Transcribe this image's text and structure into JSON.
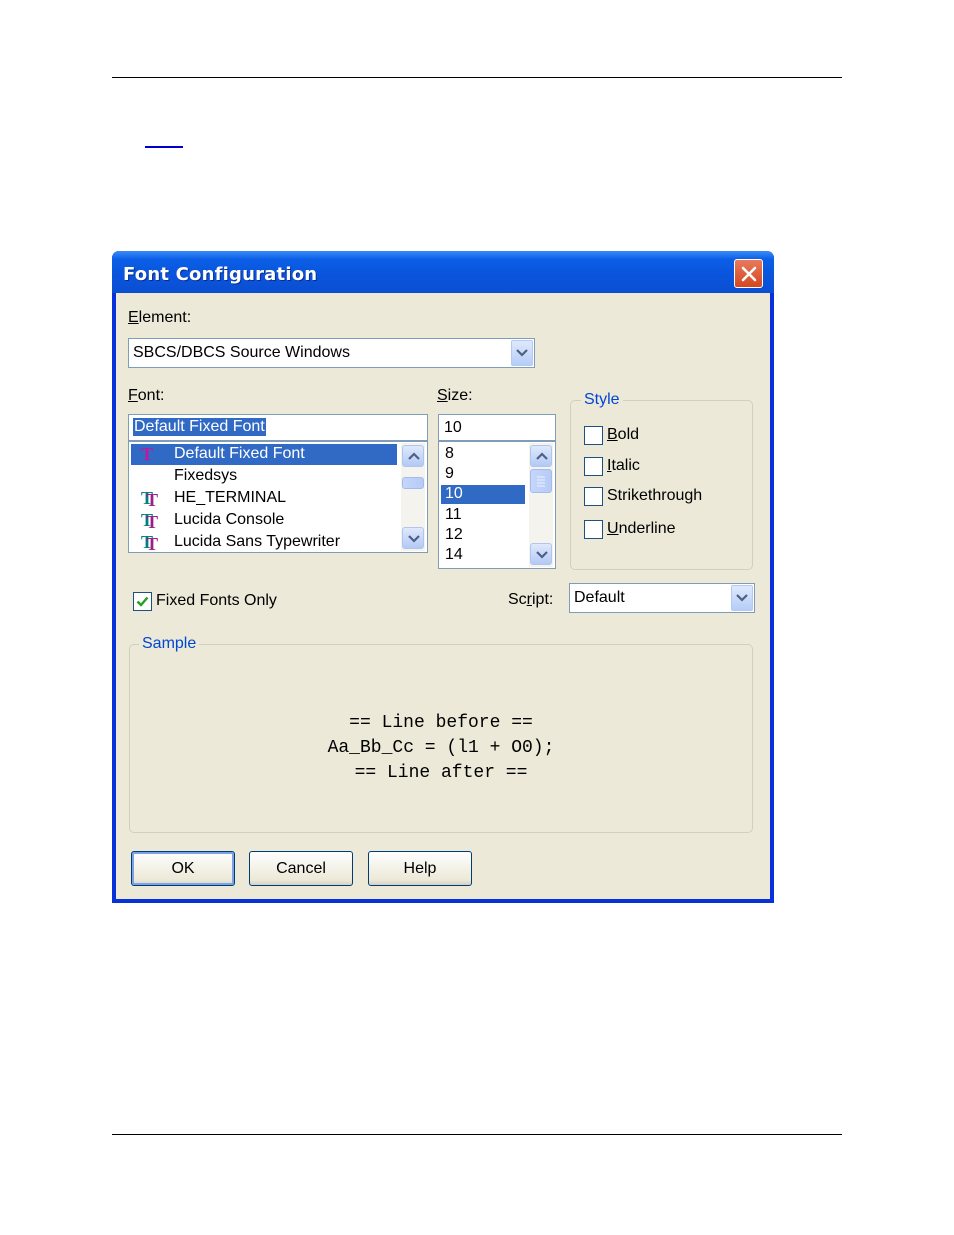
{
  "window": {
    "title": "Font Configuration"
  },
  "element": {
    "label_pre": "",
    "label_accel": "E",
    "label_post": "lement:",
    "value": "SBCS/DBCS Source Windows"
  },
  "font": {
    "label_accel": "F",
    "label_post": "ont:",
    "value": "Default Fixed Font",
    "items": [
      {
        "label": "Default Fixed Font",
        "icon": "single-t-icon",
        "selected": true
      },
      {
        "label": "Fixedsys",
        "icon": "",
        "selected": false
      },
      {
        "label": "HE_TERMINAL",
        "icon": "truetype-icon",
        "selected": false
      },
      {
        "label": "Lucida Console",
        "icon": "truetype-icon",
        "selected": false
      },
      {
        "label": "Lucida Sans Typewriter",
        "icon": "truetype-icon",
        "selected": false
      }
    ]
  },
  "size": {
    "label_accel": "S",
    "label_post": "ize:",
    "value": "10",
    "items": [
      "8",
      "9",
      "10",
      "11",
      "12",
      "14"
    ],
    "selected": "10"
  },
  "style": {
    "title": "Style",
    "options": [
      {
        "label_accel": "B",
        "label_post": "old",
        "checked": false
      },
      {
        "label_accel": "I",
        "label_post": "talic",
        "checked": false
      },
      {
        "label_accel": "",
        "label_post": "Strikethrough",
        "checked": false
      },
      {
        "label_accel": "U",
        "label_post": "nderline",
        "checked": false
      }
    ]
  },
  "fixed_fonts_only": {
    "label": "Fixed Fonts Only",
    "checked": true
  },
  "script": {
    "label_pre": "Sc",
    "label_accel": "r",
    "label_post": "ipt:",
    "value": "Default"
  },
  "sample": {
    "title": "Sample",
    "lines": [
      "== Line before ==",
      "Aa_Bb_Cc = (l1 + O0);",
      "== Line after =="
    ]
  },
  "buttons": {
    "ok": "OK",
    "cancel": "Cancel",
    "help": "Help"
  },
  "colors": {
    "titlebar": "#0a54dc",
    "dialog_bg": "#ece9d8",
    "selection": "#316ac5",
    "group_title": "#0046d5"
  }
}
